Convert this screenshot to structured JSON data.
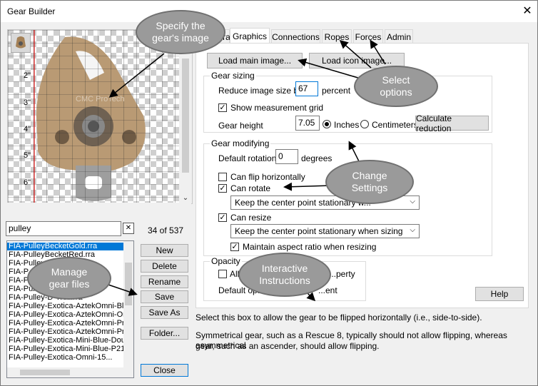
{
  "window": {
    "title": "Gear Builder",
    "close_glyph": "✕"
  },
  "preview": {
    "ruler_labels": [
      "2\"",
      "3\"",
      "4\"",
      "5\"",
      "6\""
    ],
    "watermark": "CMC ProTech"
  },
  "search": {
    "value": "pulley",
    "clear_glyph": "✕",
    "count": "34 of 537"
  },
  "file_list": [
    "FIA-PulleyBecketGold.rra",
    "FIA-PulleyBecketRed.rra",
    "FIA-Pulley...",
    "FIA-P...",
    "FIA-P...",
    "FIA-Pulley...ed.rra",
    "FIA-Pulley-D-Troll.rra",
    "FIA-Pulley-Exotica-AztekOmni-Blu",
    "FIA-Pulley-Exotica-AztekOmni-Ora",
    "FIA-Pulley-Exotica-AztekOmni-Pro",
    "FIA-Pulley-Exotica-AztekOmni-Pro",
    "FIA-Pulley-Exotica-Mini-Blue-Doul",
    "FIA-Pulley-Exotica-Mini-Blue-P21.",
    "FIA-Pulley-Exotica-Omni-15..."
  ],
  "file_buttons": {
    "new": "New",
    "delete": "Delete",
    "rename": "Rename",
    "save": "Save",
    "save_as": "Save As",
    "folder": "Folder...",
    "close": "Close"
  },
  "tabs": [
    "...eral",
    "Graphics",
    "Connections",
    "Ropes",
    "Forces",
    "Admin"
  ],
  "graphics": {
    "load_main": "Load main image...",
    "load_icon": "Load icon image...",
    "sizing": {
      "legend": "Gear sizing",
      "reduce_label": "Reduce image size by",
      "reduce_value": "67",
      "percent": "percent",
      "show_grid": "Show measurement grid",
      "height_label": "Gear height",
      "height_value": "7.05",
      "inches": "Inches",
      "centimeters": "Centimeters",
      "calc": "Calculate reduction"
    },
    "modifying": {
      "legend": "Gear modifying",
      "rotation_label": "Default rotation",
      "rotation_value": "0",
      "degrees": "degrees",
      "flip": "Can flip horizontally",
      "rotate": "Can rotate",
      "rotate_select": "Keep the center point stationary w...",
      "resize": "Can resize",
      "resize_select": "Keep the center point stationary when sizing",
      "aspect": "Maintain aspect ratio when resizing"
    },
    "opacity": {
      "legend": "Opacity",
      "allow": "Allo...",
      "allow_tail": "...perty",
      "default": "Default op...",
      "default_tail": "...ent"
    },
    "help": "Help"
  },
  "help_text": {
    "line1": "Select this box to allow the gear to be flipped horizontally (i.e., side-to-side).",
    "line2": "Symmetrical gear, such as a Rescue 8, typically should not allow flipping, whereas asymmetrical",
    "line3": "gear, such as an ascender, should allow flipping."
  },
  "callouts": {
    "specify": "Specify the\ngear's image",
    "select": "Select\noptions",
    "change": "Change\nSettings",
    "manage": "Manage\ngear files",
    "interactive": "Interactive\nInstructions"
  }
}
